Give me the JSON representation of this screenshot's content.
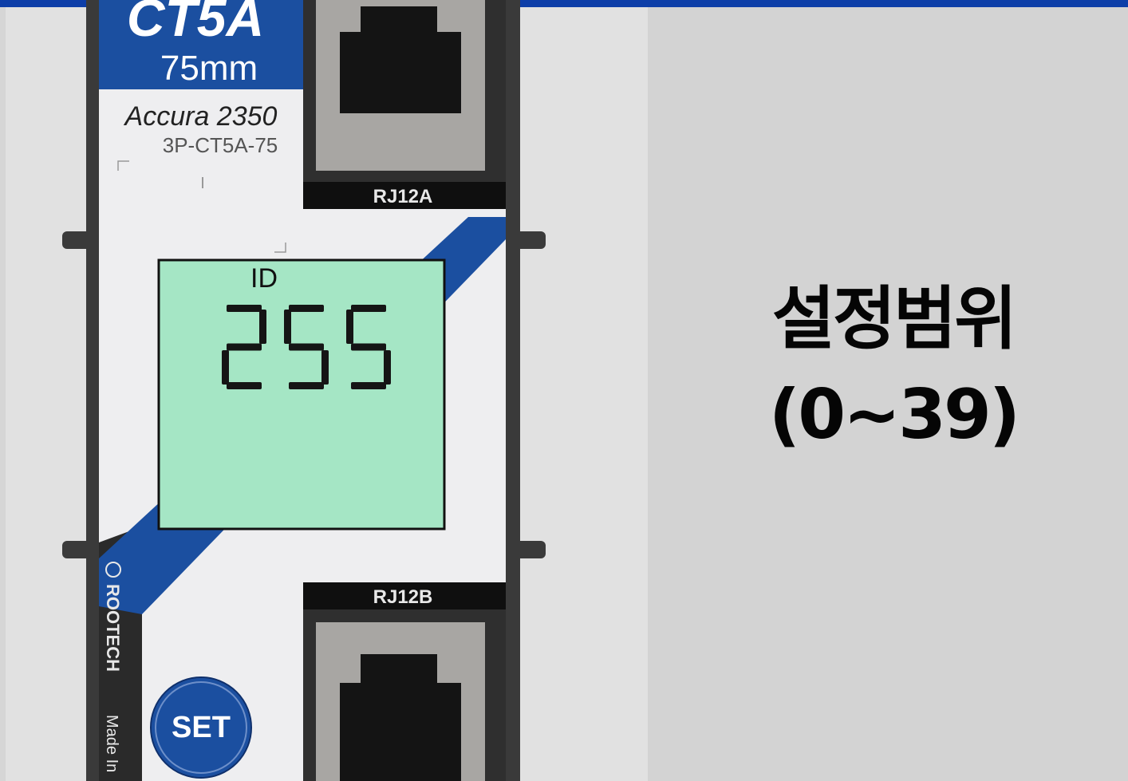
{
  "device": {
    "model_large": "CT5A",
    "size": "75mm",
    "brand": "Accura 2350",
    "part_number": "3P-CT5A-75",
    "port_a_label": "RJ12A",
    "port_b_label": "RJ12B",
    "maker": "ROOTECH",
    "made_in": "Made In",
    "lcd": {
      "id_label": "ID",
      "value": "255"
    },
    "set_button_label": "SET"
  },
  "caption": {
    "line1": "설정범위",
    "line2": "(0~39)"
  },
  "colors": {
    "top_bar": "#0d3ea8",
    "device_blue": "#1b4fa0",
    "lcd_green": "#a5e6c5",
    "device_frame": "#3a3a3a"
  },
  "icons": {
    "rj12_port": "rj12-jack-icon",
    "maker_logo": "rootech-logo-icon"
  }
}
